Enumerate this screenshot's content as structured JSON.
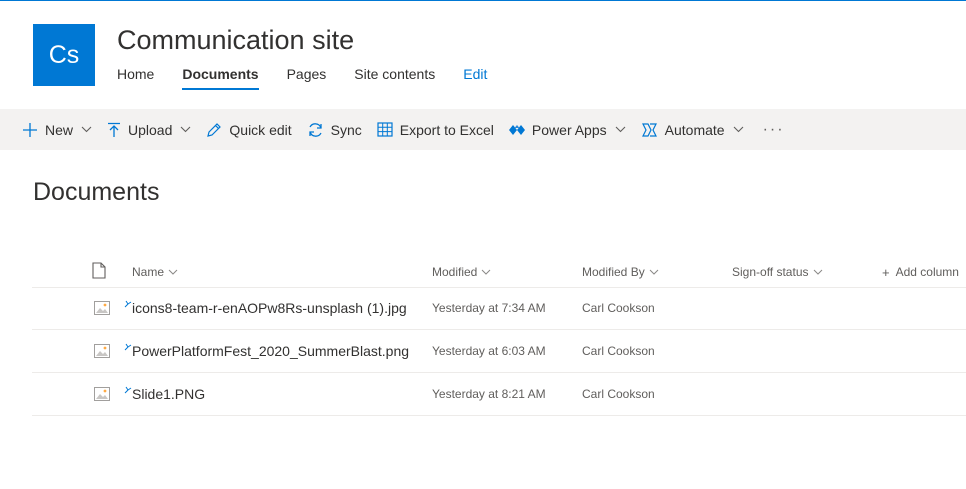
{
  "site": {
    "logo_text": "Cs",
    "title": "Communication site",
    "brand_color": "#0078d4"
  },
  "nav": {
    "items": [
      {
        "label": "Home",
        "active": false
      },
      {
        "label": "Documents",
        "active": true
      },
      {
        "label": "Pages",
        "active": false
      },
      {
        "label": "Site contents",
        "active": false
      }
    ],
    "edit_label": "Edit"
  },
  "commands": {
    "new": {
      "label": "New",
      "icon": "plus-icon"
    },
    "upload": {
      "label": "Upload",
      "icon": "upload-arrow-icon"
    },
    "quick_edit": {
      "label": "Quick edit",
      "icon": "pencil-icon"
    },
    "sync": {
      "label": "Sync",
      "icon": "sync-icon"
    },
    "export": {
      "label": "Export to Excel",
      "icon": "excel-grid-icon"
    },
    "power_apps": {
      "label": "Power Apps",
      "icon": "power-apps-icon"
    },
    "automate": {
      "label": "Automate",
      "icon": "flow-icon"
    },
    "more": {
      "label": "···",
      "icon": "more-icon"
    }
  },
  "page": {
    "title": "Documents"
  },
  "table": {
    "columns": {
      "name": "Name",
      "modified": "Modified",
      "modified_by": "Modified By",
      "signoff": "Sign-off status",
      "add_column": "Add column"
    },
    "rows": [
      {
        "name": "icons8-team-r-enAOPw8Rs-unsplash (1).jpg",
        "modified": "Yesterday at 7:34 AM",
        "modified_by": "Carl Cookson"
      },
      {
        "name": "PowerPlatformFest_2020_SummerBlast.png",
        "modified": "Yesterday at 6:03 AM",
        "modified_by": "Carl Cookson"
      },
      {
        "name": "Slide1.PNG",
        "modified": "Yesterday at 8:21 AM",
        "modified_by": "Carl Cookson"
      }
    ]
  }
}
